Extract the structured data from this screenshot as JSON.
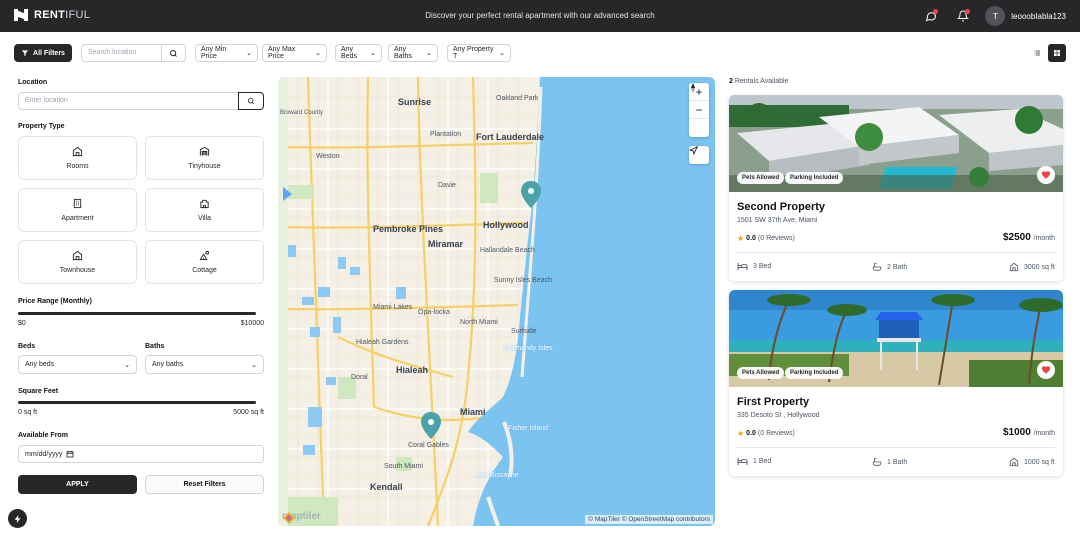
{
  "nav": {
    "brand_bold": "RENT",
    "brand_light": "IFUL",
    "tagline": "Discover your perfect rental apartment with our advanced search",
    "avatar_initial": "T",
    "username": "leooobIabla123"
  },
  "filters": {
    "all_filters": "All Filters",
    "search_placeholder": "Search location",
    "min_price": "Any Min Price",
    "max_price": "Any Max Price",
    "beds": "Any Beds",
    "baths": "Any Baths",
    "property_type": "Any Property T"
  },
  "sidebar": {
    "location_label": "Location",
    "location_placeholder": "Enter location",
    "property_type_label": "Property Type",
    "property_types": [
      "Rooms",
      "Tinyhouse",
      "Apartment",
      "Villa",
      "Townhouse",
      "Cottage"
    ],
    "price_range_label": "Price Range (Monthly)",
    "price_min": "$0",
    "price_max": "$10000",
    "beds_label": "Beds",
    "beds_value": "Any beds",
    "baths_label": "Baths",
    "baths_value": "Any baths",
    "sqft_label": "Square Feet",
    "sqft_min": "0 sq ft",
    "sqft_max": "5000 sq ft",
    "available_label": "Available From",
    "date_placeholder": "mm/dd/yyyy",
    "apply": "APPLY",
    "reset": "Reset Filters"
  },
  "map": {
    "cities": [
      {
        "name": "Sunrise",
        "size": "l"
      },
      {
        "name": "Oakland Park",
        "size": "s"
      },
      {
        "name": "Plantation",
        "size": "s"
      },
      {
        "name": "Fort Lauderdale",
        "size": "l"
      },
      {
        "name": "Weston",
        "size": "s"
      },
      {
        "name": "Davie",
        "size": "s"
      },
      {
        "name": "Pembroke Pines",
        "size": "l"
      },
      {
        "name": "Miramar",
        "size": "l"
      },
      {
        "name": "Hollywood",
        "size": "l"
      },
      {
        "name": "Hallandale Beach",
        "size": "s"
      },
      {
        "name": "Sunny Isles Beach",
        "size": "s"
      },
      {
        "name": "Miami Lakes",
        "size": "s"
      },
      {
        "name": "Opa-locka",
        "size": "s"
      },
      {
        "name": "North Miami",
        "size": "s"
      },
      {
        "name": "Surfside",
        "size": "s"
      },
      {
        "name": "Hialeah Gardens",
        "size": "s"
      },
      {
        "name": "Hialeah",
        "size": "l"
      },
      {
        "name": "Doral",
        "size": "s"
      },
      {
        "name": "Miami",
        "size": "l"
      },
      {
        "name": "Coral Gables",
        "size": "s"
      },
      {
        "name": "South Miami",
        "size": "s"
      },
      {
        "name": "Kendall",
        "size": "l"
      },
      {
        "name": "Key Biscayne",
        "size": "s"
      },
      {
        "name": "Normandy Isles",
        "size": "s"
      },
      {
        "name": "Fisher Island",
        "size": "s"
      },
      {
        "name": "Broward County",
        "size": "s"
      }
    ],
    "attribution": "© MapTiler © OpenStreetMap contributors",
    "logo_text": "maptiler"
  },
  "listings": {
    "count": "2",
    "count_label": "Rentals Available",
    "cards": [
      {
        "title": "Second Property",
        "address": "1501 SW 37th Ave, Miami",
        "rating": "0.0",
        "reviews": "(0 Reviews)",
        "price": "$2500",
        "period": "/month",
        "tag1": "Pets Allowed",
        "tag2": "Parking Included",
        "beds": "3 Bed",
        "baths": "2 Bath",
        "sqft": "3000 sq ft"
      },
      {
        "title": "First Property",
        "address": "335 Desoto St , Hollywood",
        "rating": "0.0",
        "reviews": "(0 Reviews)",
        "price": "$1000",
        "period": "/month",
        "tag1": "Pets Allowed",
        "tag2": "Parking Included",
        "beds": "1 Bed",
        "baths": "1 Bath",
        "sqft": "1000 sq ft"
      }
    ]
  },
  "colors": {
    "dark": "#27272a",
    "water": "#7cc4f0",
    "land": "#f5f0e6",
    "heart": "#ef4444"
  }
}
